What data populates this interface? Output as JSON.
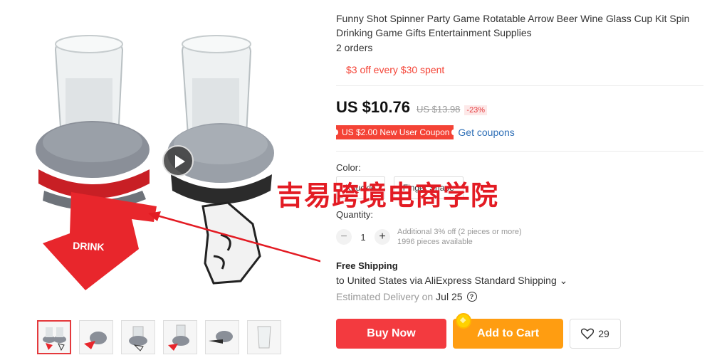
{
  "product": {
    "title": "Funny Shot Spinner Party Game Rotatable Arrow Beer Wine Glass Cup Kit Spin Drinking Game Gifts Entertainment Supplies",
    "orders": "2 orders",
    "promo": "$3 off every $30 spent",
    "price": "US $10.76",
    "old_price": "US $13.98",
    "discount": "-23%",
    "coupon": "US $2.00 New User Coupon",
    "get_coupons": "Get coupons",
    "image_label": "DRINK"
  },
  "color": {
    "label": "Color:",
    "options": [
      "Knuckle",
      "Finger Shape"
    ]
  },
  "watermark": "吉易跨境电商学院",
  "quantity": {
    "label": "Quantity:",
    "minus": "−",
    "value": "1",
    "plus": "+",
    "note1": "Additional 3% off (2 pieces or more)",
    "note2": "1996 pieces available"
  },
  "shipping": {
    "title": "Free Shipping",
    "line": "to United States via AliExpress Standard Shipping ⌄",
    "delivery_label": "Estimated Delivery on",
    "delivery_date": "Jul 25"
  },
  "actions": {
    "buy_now": "Buy Now",
    "add_to_cart": "Add to Cart",
    "wishlist_count": "29"
  },
  "icons": [
    "play-icon",
    "help-icon",
    "heart-icon",
    "coin-icon"
  ]
}
